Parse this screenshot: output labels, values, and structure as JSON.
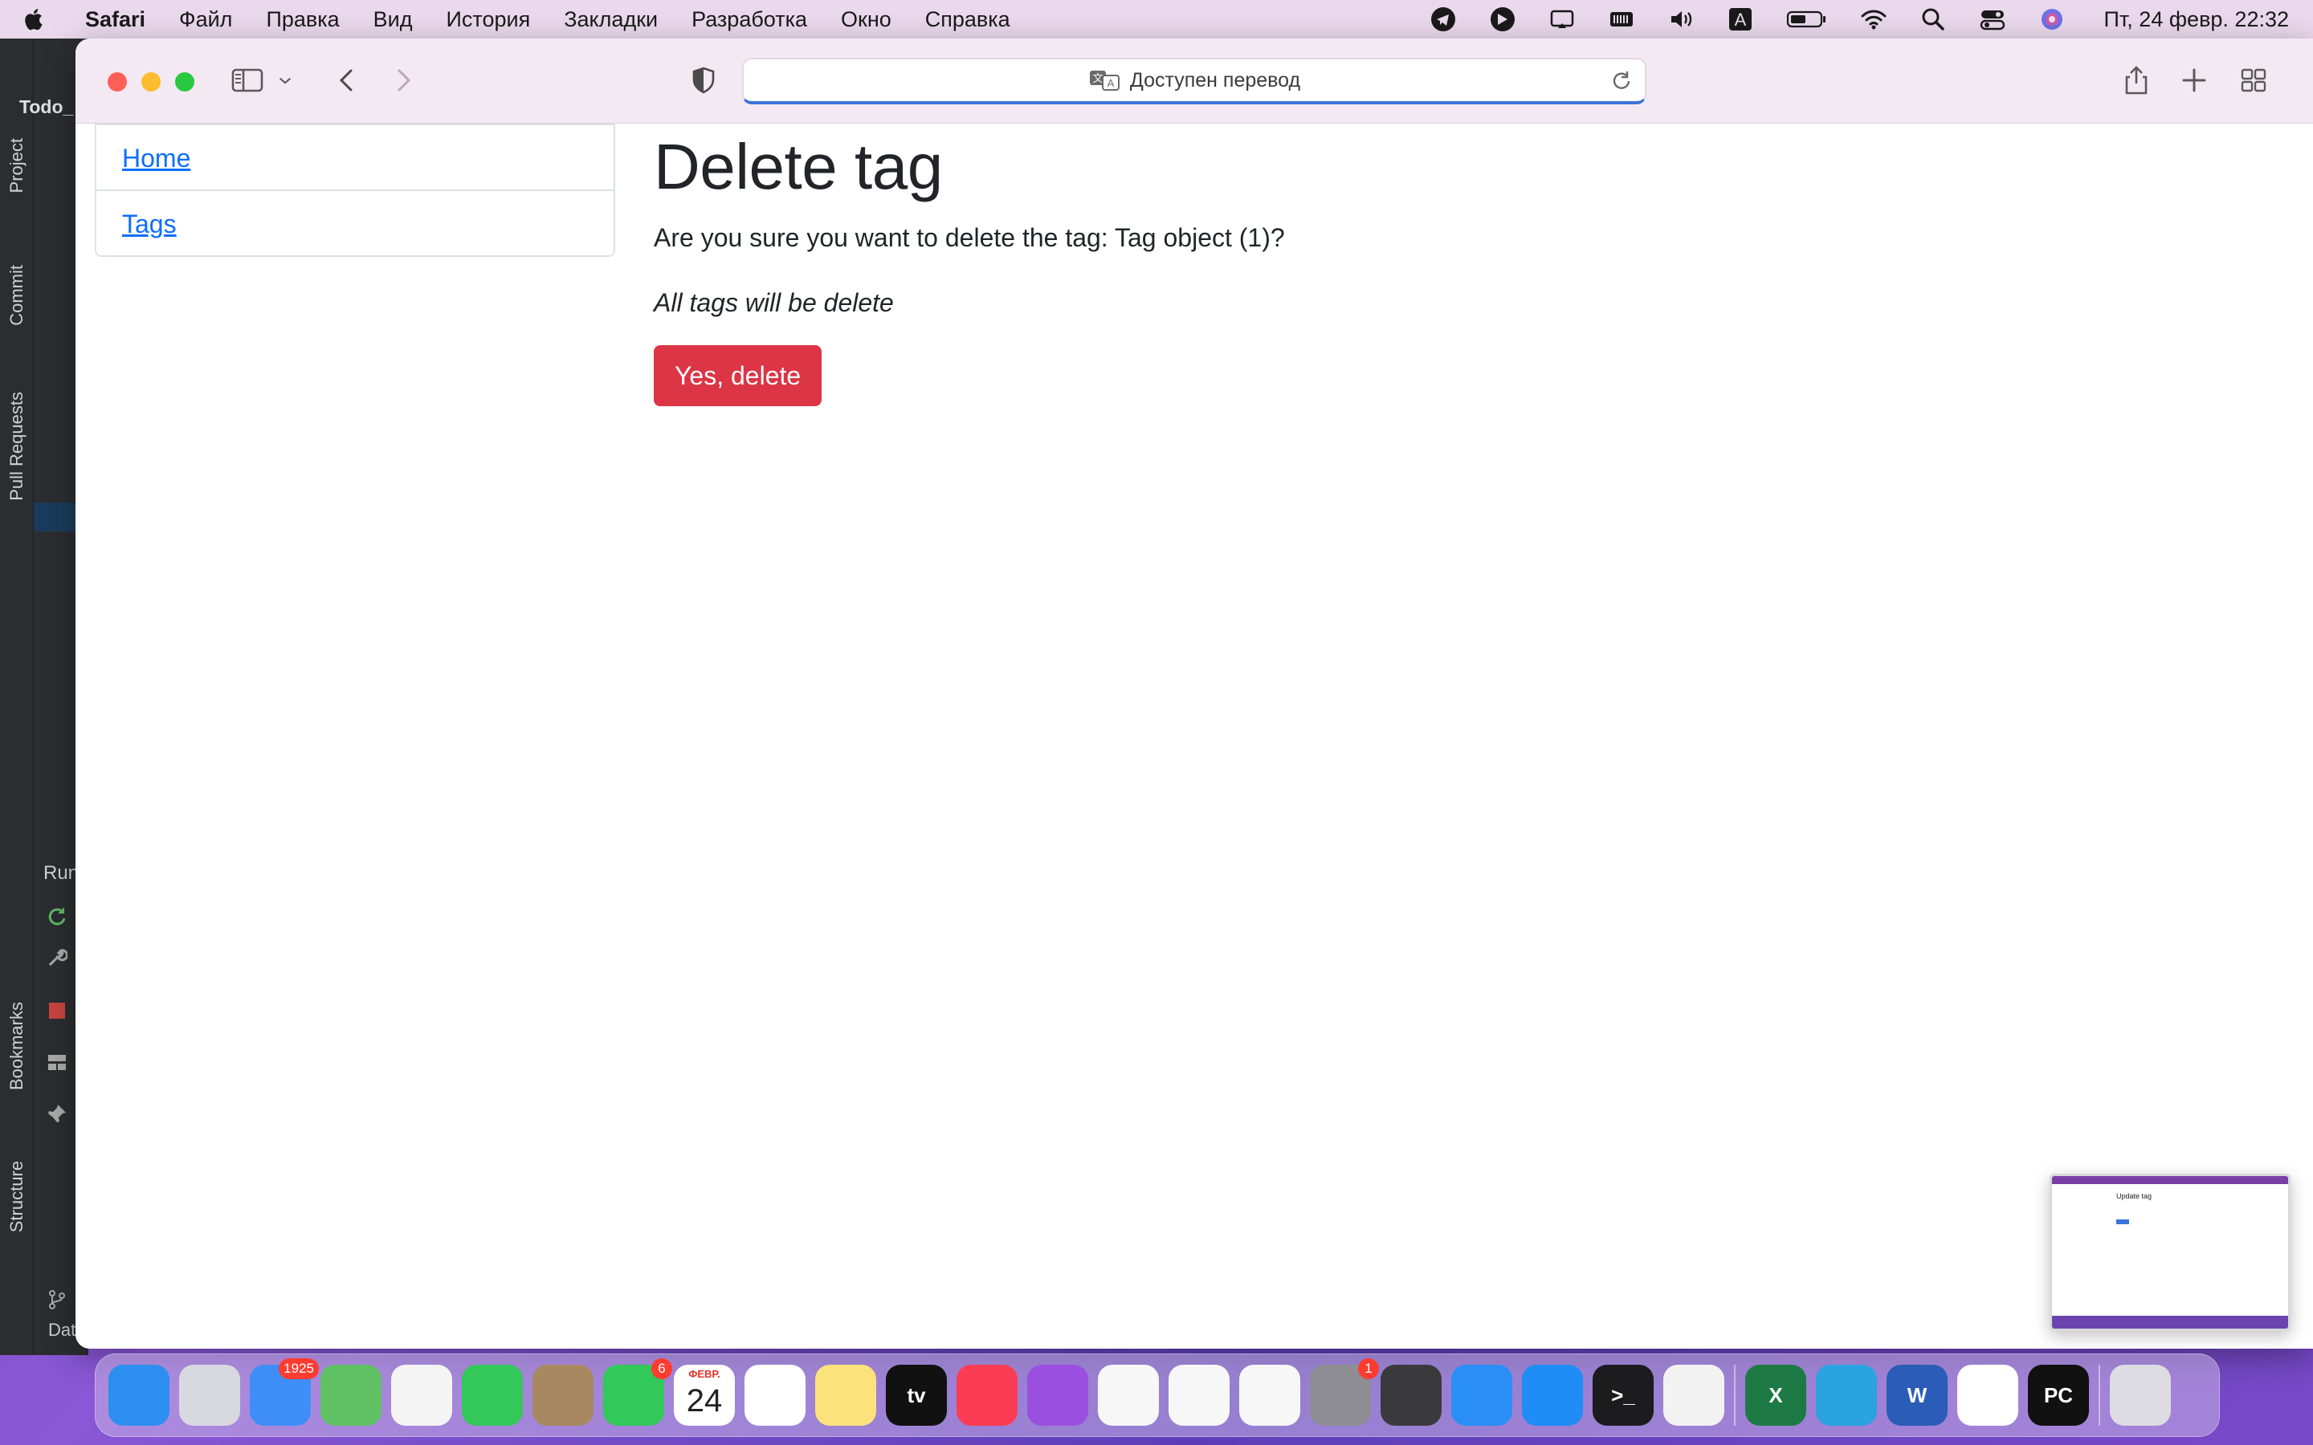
{
  "menubar": {
    "app_name": "Safari",
    "items": [
      "Файл",
      "Правка",
      "Вид",
      "История",
      "Закладки",
      "Разработка",
      "Окно",
      "Справка"
    ],
    "input_indicator": "A",
    "clock": "Пт, 24 февр.  22:32"
  },
  "ide": {
    "title": "Todo_",
    "tabs": [
      "Project",
      "Commit",
      "Pull Requests",
      "Bookmarks",
      "Structure"
    ],
    "run_label": "Run",
    "data_label": "Dat"
  },
  "browser": {
    "address_text": "Доступен перевод"
  },
  "page": {
    "nav": [
      {
        "label": "Home"
      },
      {
        "label": "Tags"
      }
    ],
    "heading": "Delete tag",
    "question": "Are you sure you want to delete the tag: Tag object (1)?",
    "note": "All tags will be delete",
    "confirm_button": "Yes, delete"
  },
  "thumbnail": {
    "title": "Update tag"
  },
  "dock": {
    "apps": [
      {
        "name": "Finder",
        "icon": "finder-icon",
        "color": "#2c8ff0"
      },
      {
        "name": "Launchpad",
        "icon": "launchpad-icon",
        "color": "#d8d8e0"
      },
      {
        "name": "Mail",
        "icon": "mail-icon",
        "color": "#3f8ef7",
        "badge": "1925"
      },
      {
        "name": "Maps",
        "icon": "maps-icon",
        "color": "#5fc163"
      },
      {
        "name": "Photos",
        "icon": "photos-icon",
        "color": "#f4f4f4"
      },
      {
        "name": "Messages",
        "icon": "messages-icon",
        "color": "#34c759"
      },
      {
        "name": "Contacts",
        "icon": "contacts-icon",
        "color": "#a88860"
      },
      {
        "name": "FaceTime",
        "icon": "facetime-icon",
        "color": "#32c85a",
        "badge": "6"
      },
      {
        "name": "Calendar",
        "icon": "calendar-icon",
        "color": "#ffffff",
        "month": "ФЕВР.",
        "day": "24"
      },
      {
        "name": "Reminders",
        "icon": "reminders-icon",
        "color": "#ffffff"
      },
      {
        "name": "Notes",
        "icon": "notes-icon",
        "color": "#fbe27a"
      },
      {
        "name": "TV",
        "icon": "tv-icon",
        "color": "#111111",
        "text": "tv"
      },
      {
        "name": "Music",
        "icon": "music-icon",
        "color": "#fb3c55"
      },
      {
        "name": "Podcasts",
        "icon": "podcasts-icon",
        "color": "#9b4fe0"
      },
      {
        "name": "Keynote",
        "icon": "keynote-icon",
        "color": "#f7f7f7"
      },
      {
        "name": "Numbers",
        "icon": "numbers-icon",
        "color": "#f7f7f7"
      },
      {
        "name": "Pages",
        "icon": "pages-icon",
        "color": "#f7f7f7"
      },
      {
        "name": "System Preferences",
        "icon": "settings-icon",
        "color": "#8d8d93",
        "badge": "1"
      },
      {
        "name": "Calculator",
        "icon": "calculator-icon",
        "color": "#3a3a3c"
      },
      {
        "name": "Safari",
        "icon": "safari-icon",
        "color": "#2a8ef7"
      },
      {
        "name": "App Store",
        "icon": "appstore-icon",
        "color": "#1f8df5"
      },
      {
        "name": "Terminal",
        "icon": "terminal-icon",
        "color": "#1c1c1e",
        "text": ">_"
      },
      {
        "name": "Chrome",
        "icon": "chrome-icon",
        "color": "#f2f2f2"
      },
      {
        "name": "Excel",
        "icon": "excel-icon",
        "color": "#1d7a45",
        "text": "X"
      },
      {
        "name": "Telegram",
        "icon": "telegram-icon",
        "color": "#2aa3e0"
      },
      {
        "name": "Word",
        "icon": "word-icon",
        "color": "#2a5cb8",
        "text": "W"
      },
      {
        "name": "VS Code",
        "icon": "vscode-icon",
        "color": "#ffffff"
      },
      {
        "name": "PyCharm",
        "icon": "pycharm-icon",
        "color": "#111111",
        "text": "PC"
      },
      {
        "name": "Trash",
        "icon": "trash-icon",
        "color": "#dcdce2"
      }
    ]
  }
}
